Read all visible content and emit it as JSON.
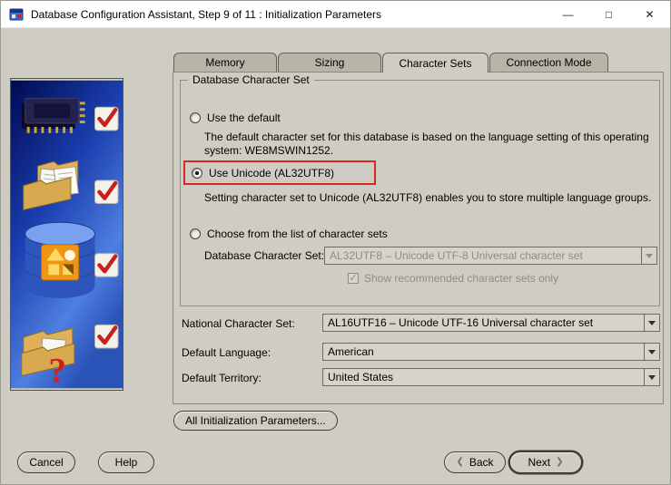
{
  "window": {
    "title": "Database Configuration Assistant, Step 9 of 11 : Initialization Parameters",
    "controls": {
      "minimize": "—",
      "maximize": "□",
      "close": "✕"
    }
  },
  "tabs": [
    {
      "label": "Memory",
      "active": false
    },
    {
      "label": "Sizing",
      "active": false
    },
    {
      "label": "Character Sets",
      "active": true
    },
    {
      "label": "Connection Mode",
      "active": false
    }
  ],
  "character_set_group": {
    "title": "Database Character Set",
    "use_default": {
      "label": "Use the default",
      "selected": false,
      "description": "The default character set for this database is based on the language setting of this operating system: WE8MSWIN1252."
    },
    "use_unicode": {
      "label": "Use Unicode (AL32UTF8)",
      "selected": true,
      "highlighted": true,
      "description": "Setting character set to Unicode (AL32UTF8) enables you to store multiple language groups."
    },
    "choose_from_list": {
      "label": "Choose from the list of character sets",
      "selected": false
    },
    "database_character_set": {
      "label": "Database Character Set:",
      "value": "AL32UTF8 – Unicode UTF-8 Universal character set",
      "disabled": true
    },
    "show_recommended": {
      "label": "Show recommended character sets only",
      "checked": true,
      "disabled": true
    }
  },
  "fields": {
    "national_character_set": {
      "label": "National Character Set:",
      "value": "AL16UTF16 – Unicode UTF-16 Universal character set"
    },
    "default_language": {
      "label": "Default Language:",
      "value": "American"
    },
    "default_territory": {
      "label": "Default Territory:",
      "value": "United States"
    }
  },
  "buttons": {
    "all_init_params": "All Initialization Parameters...",
    "cancel": "Cancel",
    "help": "Help",
    "back": "Back",
    "next": "Next"
  },
  "icons": {
    "back_chevron": "❮",
    "next_chevron": "❯",
    "check_glyph": "✓",
    "question_mark": "?"
  },
  "colors": {
    "highlight_red": "#cf2b22",
    "panel_bg": "#cfccc3",
    "sidebar_blue_dark": "#000a50",
    "sidebar_blue_light": "#4f7fe0"
  }
}
